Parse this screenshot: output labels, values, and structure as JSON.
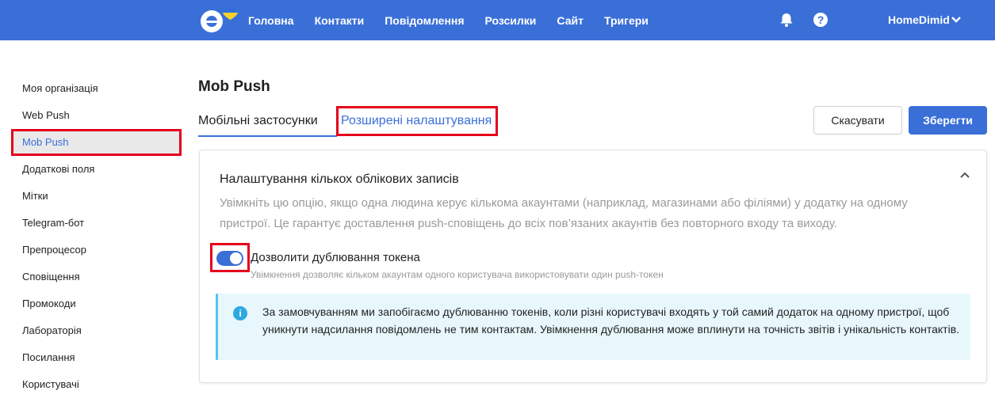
{
  "topbar": {
    "nav": [
      "Головна",
      "Контакти",
      "Повідомлення",
      "Розсилки",
      "Сайт",
      "Тригери"
    ],
    "help_glyph": "?",
    "user_name": "HomeDimid",
    "icons": [
      "logo-icon",
      "bell-icon",
      "help-icon",
      "chevron-down-icon"
    ],
    "color": "#3a6fd8"
  },
  "sidebar": {
    "items": [
      "Моя організація",
      "Web Push",
      "Mob Push",
      "Додаткові поля",
      "Мітки",
      "Telegram-бот",
      "Препроцесор",
      "Сповіщення",
      "Промокоди",
      "Лабораторія",
      "Посилання",
      "Користувачі"
    ],
    "active": "Mob Push"
  },
  "main": {
    "title": "Mob Push",
    "tabs": [
      "Мобільні застосунки",
      "Розширені налаштування"
    ],
    "active_tab": "Мобільні застосунки",
    "buttons": {
      "cancel": "Скасувати",
      "save": "Зберегти"
    },
    "section": {
      "title": "Налаштування кількох облікових записів",
      "description": "Увімкніть цю опцію, якщо одна людина керує кількома акаунтами (наприклад, магазинами або філіями) у додатку на одному пристрої. Це гарантує доставлення push-сповіщень до всіх пов’язаних акаунтів без повторного входу та виходу.",
      "toggle_label": "Дозволити дублювання токена",
      "toggle_hint": "Увімкнення дозволяє кільком акаунтам одного користувача використовувати один push-токен",
      "toggle_on": true,
      "info_glyph": "i",
      "info_text": "За замовчуванням ми запобігаємо дублюванню токенів, коли різні користувачі входять у той самий додаток на одному пристрої, щоб уникнути надсилання повідомлень не тим контактам. Увімкнення дублювання може вплинути на точність звітів і унікальність контактів."
    }
  }
}
